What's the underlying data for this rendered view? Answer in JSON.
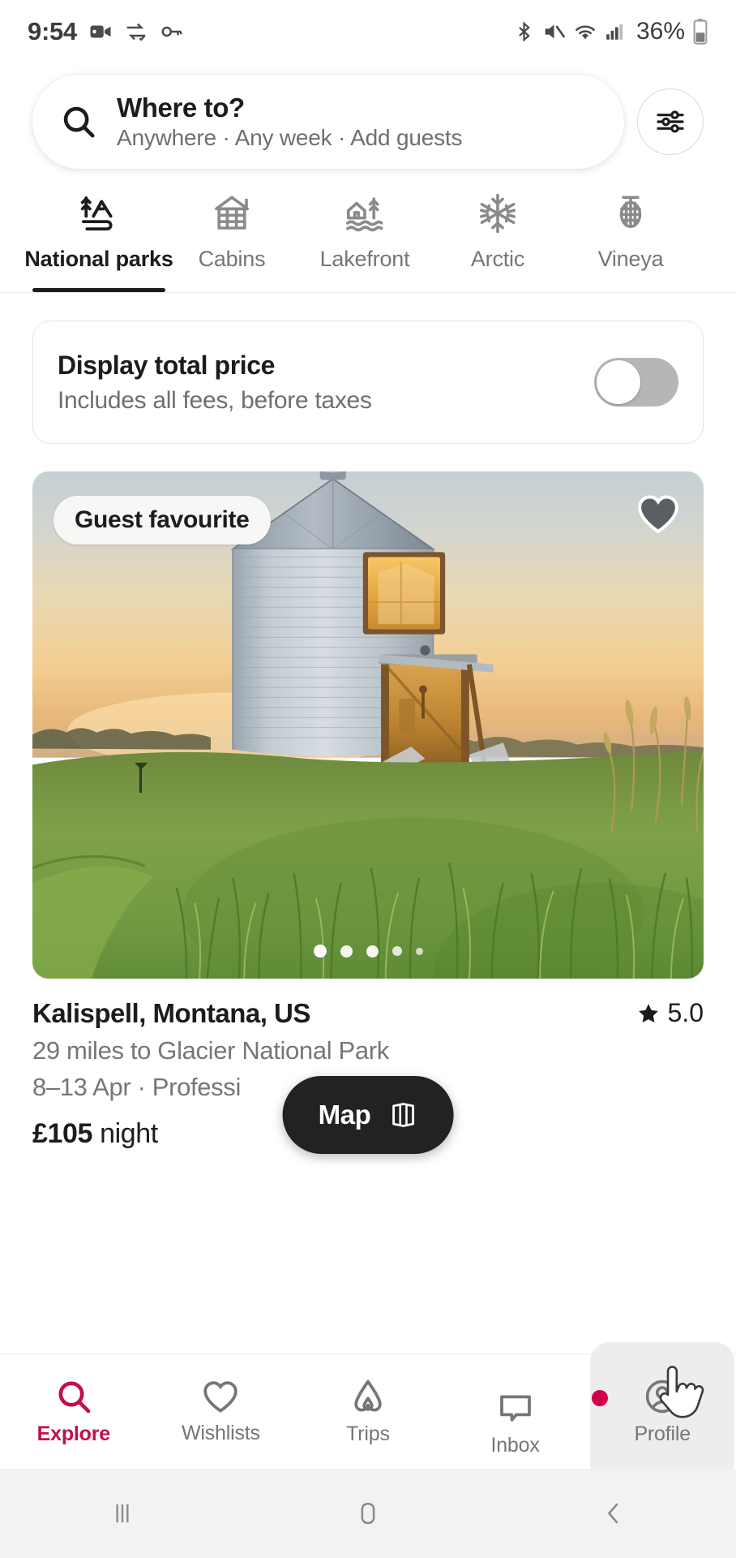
{
  "status_bar": {
    "time": "9:54",
    "battery_percent": "36%",
    "left_icons": [
      "camera-icon",
      "data-transfer-icon",
      "vpn-key-icon"
    ],
    "right_icons": [
      "bluetooth-icon",
      "mute-icon",
      "wifi-icon",
      "cellular-signal-icon",
      "battery-icon"
    ]
  },
  "search": {
    "icon": "search-icon",
    "title": "Where to?",
    "subtitle": "Anywhere · Any week · Add guests",
    "filter_icon": "filter-sliders-icon"
  },
  "tabs": [
    {
      "label": "National parks",
      "icon": "national-parks-icon",
      "active": true
    },
    {
      "label": "Cabins",
      "icon": "cabin-icon",
      "active": false
    },
    {
      "label": "Lakefront",
      "icon": "lakefront-icon",
      "active": false
    },
    {
      "label": "Arctic",
      "icon": "snowflake-icon",
      "active": false
    },
    {
      "label": "Vineya",
      "icon": "grapes-icon",
      "active": false
    }
  ],
  "price_toggle": {
    "title": "Display total price",
    "subtitle": "Includes all fees, before taxes",
    "state": "off"
  },
  "listing": {
    "badge": "Guest favourite",
    "favourite_icon": "heart-icon",
    "photo_count": 5,
    "active_photo": 1,
    "title": "Kalispell, Montana, US",
    "distance": "29 miles to Glacier National Park",
    "dates": "8–13 Apr · Professi",
    "rating": "5.0",
    "rating_icon": "star-icon",
    "price_amount": "£105",
    "price_unit": "night"
  },
  "map_button": {
    "label": "Map",
    "icon": "map-icon"
  },
  "bottom_nav": [
    {
      "label": "Explore",
      "icon": "search-icon",
      "active": true,
      "badge": false,
      "pressed": false
    },
    {
      "label": "Wishlists",
      "icon": "heart-outline-icon",
      "active": false,
      "badge": false,
      "pressed": false
    },
    {
      "label": "Trips",
      "icon": "airbnb-bellhop-icon",
      "active": false,
      "badge": false,
      "pressed": false
    },
    {
      "label": "Inbox",
      "icon": "chat-bubble-icon",
      "active": false,
      "badge": true,
      "pressed": false
    },
    {
      "label": "Profile",
      "icon": "account-circle-icon",
      "active": false,
      "badge": false,
      "pressed": true
    }
  ],
  "android_nav": [
    {
      "icon": "recents-icon"
    },
    {
      "icon": "home-icon"
    },
    {
      "icon": "back-icon"
    }
  ],
  "colors": {
    "brand": "#c01048",
    "badge_dot": "#d1004a",
    "text_primary": "#1c1c1c",
    "text_secondary": "#767676",
    "map_pill_bg": "#222222"
  }
}
